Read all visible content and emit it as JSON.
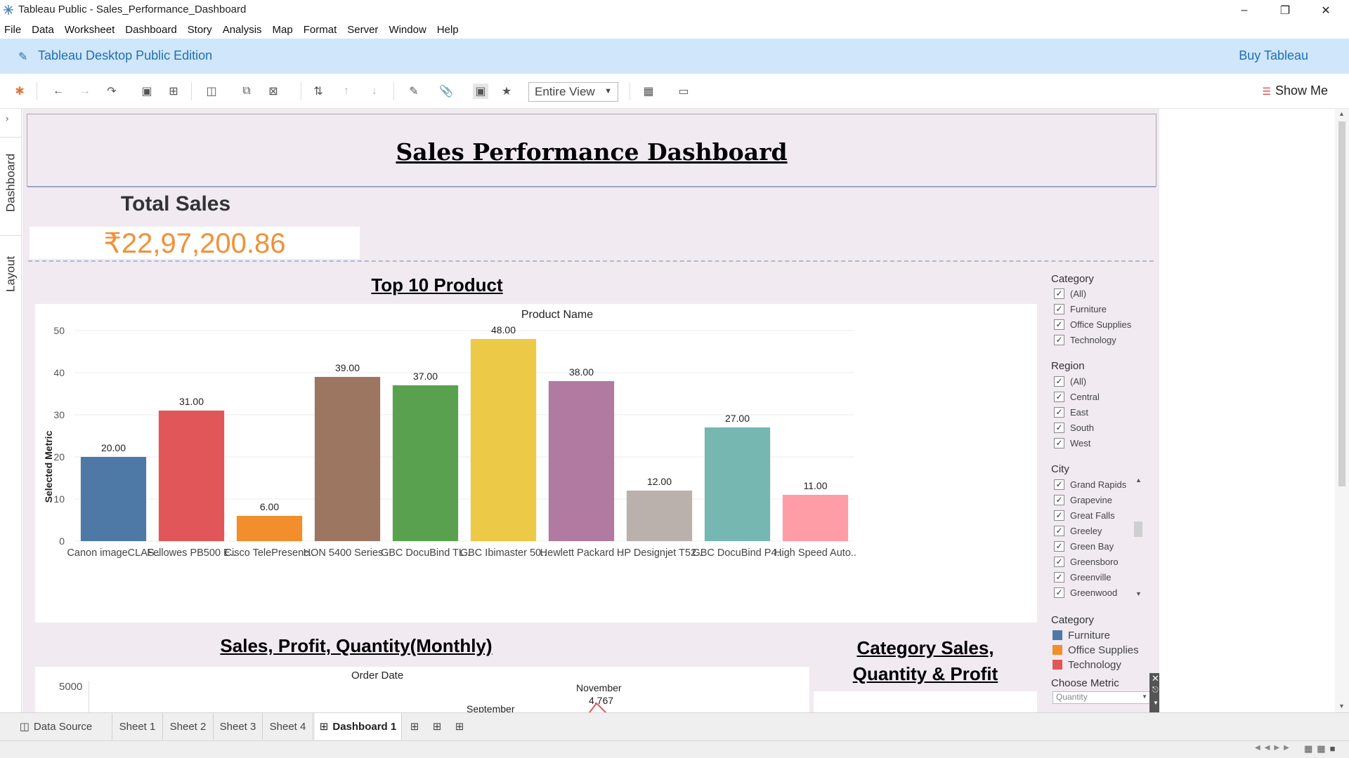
{
  "window": {
    "title": "Tableau Public - Sales_Performance_Dashboard",
    "minimize_icon": "minimize-icon",
    "maximize_icon": "restore-icon",
    "close_icon": "close-icon"
  },
  "menu": [
    "File",
    "Data",
    "Worksheet",
    "Dashboard",
    "Story",
    "Analysis",
    "Map",
    "Format",
    "Server",
    "Window",
    "Help"
  ],
  "banner": {
    "edition": "Tableau Desktop Public Edition",
    "buy": "Buy Tableau"
  },
  "toolbar": {
    "view_select": "Entire View",
    "show_me": "Show Me"
  },
  "side_tabs": [
    "Dashboard",
    "Layout"
  ],
  "dashboard": {
    "title": "Sales Performance Dashboard",
    "total_sales_label": "Total Sales",
    "total_sales_value": "₹22,97,200.86",
    "top10_title": "Top 10 Product",
    "monthly_title": "Sales, Profit, Quantity(Monthly)",
    "category_title_line1": "Category Sales,",
    "category_title_line2": "Quantity & Profit",
    "monthly_header": "Order Date",
    "monthly_y_tick": "5000",
    "monthly_label_month": "November",
    "monthly_label_value": "4,767",
    "monthly_label_month2": "September"
  },
  "chart_data": {
    "type": "bar",
    "title": "Product Name",
    "ylabel": "Selected Metric",
    "xlabel": "",
    "ylim": [
      0,
      50
    ],
    "yticks": [
      "0",
      "10",
      "20",
      "30",
      "40",
      "50"
    ],
    "categories": [
      "Canon imageCLAS..",
      "Fellowes PB500 E..",
      "Cisco TelePresenc..",
      "HON 5400 Series ..",
      "GBC DocuBind TL..",
      "GBC Ibimaster 50..",
      "Hewlett Packard ..",
      "HP Designjet T52..",
      "GBC DocuBind P4..",
      "High Speed Auto.."
    ],
    "values": [
      20,
      31,
      6,
      39,
      37,
      48,
      38,
      12,
      27,
      11
    ],
    "data_labels": [
      "20.00",
      "31.00",
      "6.00",
      "39.00",
      "37.00",
      "48.00",
      "38.00",
      "12.00",
      "27.00",
      "11.00"
    ],
    "colors": [
      "#4e79a7",
      "#e15759",
      "#f28e2b",
      "#9c7660",
      "#59a14f",
      "#edc948",
      "#b07aa1",
      "#bab0ac",
      "#76b7b2",
      "#ff9da7"
    ],
    "grid": true
  },
  "filters": {
    "category": {
      "title": "Category",
      "items": [
        "(All)",
        "Furniture",
        "Office Supplies",
        "Technology"
      ]
    },
    "region": {
      "title": "Region",
      "items": [
        "(All)",
        "Central",
        "East",
        "South",
        "West"
      ]
    },
    "city": {
      "title": "City",
      "items": [
        "Grand Rapids",
        "Grapevine",
        "Great Falls",
        "Greeley",
        "Green Bay",
        "Greensboro",
        "Greenville",
        "Greenwood"
      ]
    },
    "legend": {
      "title": "Category",
      "items": [
        {
          "label": "Furniture",
          "color": "#4e79a7"
        },
        {
          "label": "Office Supplies",
          "color": "#f28e2b"
        },
        {
          "label": "Technology",
          "color": "#e15759"
        }
      ]
    },
    "metric": {
      "title": "Choose Metric",
      "value": "Quantity"
    }
  },
  "sheet_tabs": {
    "data_source": "Data Source",
    "sheets": [
      "Sheet 1",
      "Sheet 2",
      "Sheet 3",
      "Sheet 4",
      "Dashboard 1"
    ],
    "active": "Dashboard 1"
  }
}
